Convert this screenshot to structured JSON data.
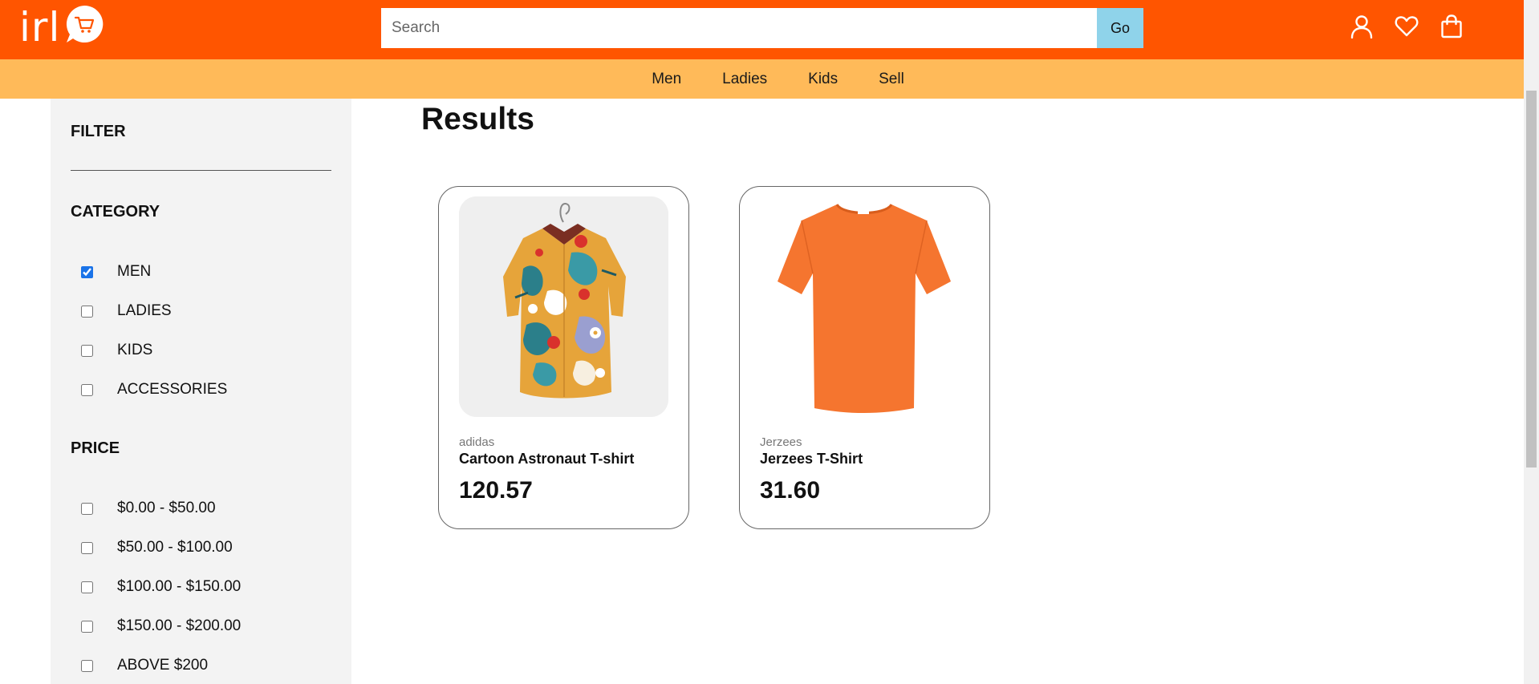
{
  "header": {
    "logo_text": "irl",
    "search_placeholder": "Search",
    "search_value": "",
    "go_label": "Go",
    "icons": [
      "user-icon",
      "heart-icon",
      "shopping-bag-icon"
    ]
  },
  "nav": {
    "items": [
      {
        "label": "Men"
      },
      {
        "label": "Ladies"
      },
      {
        "label": "Kids"
      },
      {
        "label": "Sell"
      }
    ]
  },
  "sidebar": {
    "filter_title": "FILTER",
    "category": {
      "title": "CATEGORY",
      "options": [
        {
          "label": "MEN",
          "checked": true
        },
        {
          "label": "LADIES",
          "checked": false
        },
        {
          "label": "KIDS",
          "checked": false
        },
        {
          "label": "ACCESSORIES",
          "checked": false
        }
      ]
    },
    "price": {
      "title": "PRICE",
      "options": [
        {
          "label": "$0.00 - $50.00",
          "checked": false
        },
        {
          "label": "$50.00 - $100.00",
          "checked": false
        },
        {
          "label": "$100.00 - $150.00",
          "checked": false
        },
        {
          "label": "$150.00 - $200.00",
          "checked": false
        },
        {
          "label": "ABOVE $200",
          "checked": false
        }
      ]
    }
  },
  "main": {
    "title": "Results",
    "products": [
      {
        "brand": "adidas",
        "name": "Cartoon Astronaut T-shirt",
        "price": "120.57"
      },
      {
        "brand": "Jerzees",
        "name": "Jerzees T-Shirt",
        "price": "31.60"
      }
    ]
  },
  "colors": {
    "header": "#ff5500",
    "nav": "#ffba59",
    "go_button": "#8fd3ea",
    "sidebar": "#f3f3f3",
    "tshirt": "#f5752f"
  }
}
